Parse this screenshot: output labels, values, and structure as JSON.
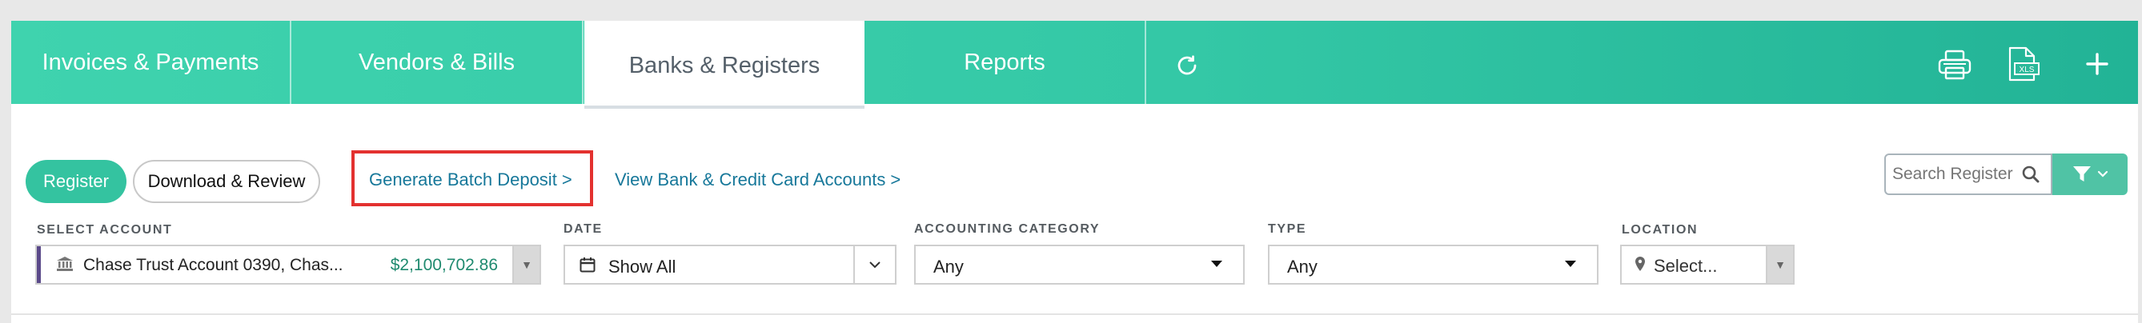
{
  "tabs": [
    {
      "label": "Invoices & Payments"
    },
    {
      "label": "Vendors & Bills"
    },
    {
      "label": "Banks & Registers"
    },
    {
      "label": "Reports"
    }
  ],
  "toolbar_icons": {
    "refresh": "refresh-icon",
    "print": "printer-icon",
    "export": "xls-export-icon",
    "xls_text": "XLS",
    "add": "plus-icon"
  },
  "actions": {
    "register": "Register",
    "download_review": "Download & Review",
    "generate_batch": "Generate Batch Deposit >",
    "view_accounts": "View Bank & Credit Card Accounts >"
  },
  "search": {
    "placeholder": "Search Register"
  },
  "filters": {
    "account": {
      "label": "SELECT ACCOUNT",
      "value": "Chase Trust Account 0390, Chas...",
      "balance": "$2,100,702.86"
    },
    "date": {
      "label": "DATE",
      "value": "Show All"
    },
    "category": {
      "label": "ACCOUNTING CATEGORY",
      "value": "Any"
    },
    "type": {
      "label": "TYPE",
      "value": "Any"
    },
    "location": {
      "label": "LOCATION",
      "value": "Select..."
    }
  },
  "colors": {
    "accent": "#34c3a0",
    "link": "#17789a",
    "balance": "#1f8a6f",
    "highlight": "#e3312f",
    "account_marker": "#5b4a8a"
  }
}
